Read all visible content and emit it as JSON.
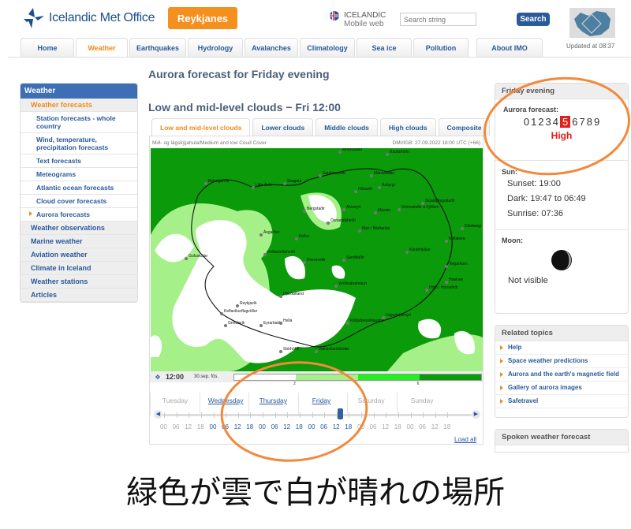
{
  "header": {
    "logo_text": "Icelandic Met Office",
    "region_button": "Reykjanes",
    "language": "ICELANDIC",
    "mobile": "Mobile web",
    "search_placeholder": "Search string",
    "search_button": "Search",
    "updated": "Updated at 08:37"
  },
  "nav": [
    "Home",
    "Weather",
    "Earthquakes",
    "Hydrology",
    "Avalanches",
    "Climatology",
    "Sea ice",
    "Pollution",
    "About IMO"
  ],
  "nav_active": "Weather",
  "sidebar": {
    "title": "Weather",
    "items": [
      {
        "label": "Weather forecasts",
        "type": "top sel"
      },
      {
        "label": "Station forecasts - whole country",
        "type": "sub"
      },
      {
        "label": "Wind, temperature, precipitation forecasts",
        "type": "sub"
      },
      {
        "label": "Text forecasts",
        "type": "sub"
      },
      {
        "label": "Meteograms",
        "type": "sub"
      },
      {
        "label": "Atlantic ocean forecasts",
        "type": "sub"
      },
      {
        "label": "Cloud cover forecasts",
        "type": "sub"
      },
      {
        "label": "Aurora forecasts",
        "type": "sub cur"
      },
      {
        "label": "Weather observations",
        "type": "top"
      },
      {
        "label": "Marine weather",
        "type": "top"
      },
      {
        "label": "Aviation weather",
        "type": "top"
      },
      {
        "label": "Climate in Iceland",
        "type": "top"
      },
      {
        "label": "Weather stations",
        "type": "top"
      },
      {
        "label": "Articles",
        "type": "top"
      }
    ]
  },
  "main": {
    "title": "Aurora forecast for Friday evening",
    "subtitle": "Low and mid-level clouds − Fri 12:00",
    "tabs": [
      "Low and mid-level clouds",
      "Lower clouds",
      "Middle clouds",
      "High clouds",
      "Composite"
    ],
    "map_caption_left": "Mið- og lágskýjahula/Medium and low Coud Cover",
    "map_caption_right": "DMI/IGB: 27.09.2022 18:00 UTC (+66)",
    "map_places": [
      "Bolungarvík",
      "Litla-Ávík",
      "Skagatá",
      "Sauðanesviti",
      "Raufarhöfn",
      "Mánárbakki",
      "Möðrudalur",
      "Húsavík",
      "Ásbyrgi",
      "Akureyri",
      "Mývatn",
      "Grímsstaðir á Fjöllum",
      "Skjaldþingsstaðir",
      "Dalatangi",
      "Kollaleira",
      "Kárahnjúkar",
      "Teigarhorn",
      "Hvalnes",
      "Höfn í Hornafirði",
      "Hveravellir",
      "Sandbúðir",
      "Veiðivatnahraun",
      "Hjarðarland",
      "Reykjavík",
      "Keflavíkurflugvöllur",
      "Grindavík",
      "Eyrarbakki",
      "Hella",
      "Stórhöfði",
      "Vatnsskarðshólar",
      "Kirkjubæjarklaustur",
      "Fagurhólsmýri",
      "Gufuskálar",
      "Öxnadalsheiði",
      "Holtavörðuheiði",
      "Bergstaðir",
      "Kolka",
      "Mýri í Bárðardal",
      "Ásgarður"
    ],
    "time": "12:00",
    "date": "30.sep. fös.",
    "legend_ticks": [
      "2",
      "4",
      "6"
    ],
    "legend_colors": [
      "#ffffff",
      "#a6f08a",
      "#22ee22",
      "#0a9a0a"
    ],
    "days": [
      "Tuesday",
      "Wednesday",
      "Thursday",
      "Friday",
      "Saturday",
      "Sunday"
    ],
    "linked_days": [
      "Wednesday",
      "Thursday",
      "Friday"
    ],
    "hours": [
      "00",
      "06",
      "12",
      "18"
    ],
    "selected": "Friday 12",
    "load_all": "Load all"
  },
  "right": {
    "panel_title": "Friday evening",
    "aurora_label": "Aurora forecast:",
    "scale": [
      "0",
      "1",
      "2",
      "3",
      "4",
      "5",
      "6",
      "7",
      "8",
      "9"
    ],
    "aurora_value": 5,
    "aurora_text": "High",
    "sun_label": "Sun:",
    "sunset": "Sunset: 19:00",
    "dark": "Dark: 19:47 to 06:49",
    "sunrise": "Sunrise: 07:36",
    "moon_label": "Moon:",
    "moon_status": "Not visible",
    "related_title": "Related topics",
    "related": [
      "Help",
      "Space weather predictions",
      "Aurora and the earth's magnetic field",
      "Gallery of aurora images",
      "Safetravel"
    ],
    "spoken_title": "Spoken weather forecast"
  },
  "caption": "緑色が雲で白が晴れの場所",
  "colors": {
    "accent": "#f08a1c",
    "link": "#2a5a9a",
    "cloud": "#0a9a0a",
    "aurora_high": "#e0201a"
  }
}
